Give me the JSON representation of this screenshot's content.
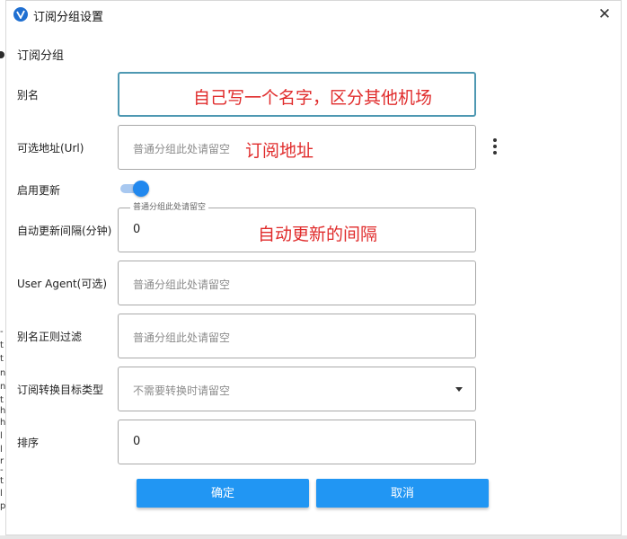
{
  "dialog": {
    "title": "订阅分组设置",
    "close_label": "✕"
  },
  "section_title": "订阅分组",
  "fields": {
    "alias": {
      "label": "别名",
      "value": "",
      "annotation": "自己写一个名字，区分其他机场"
    },
    "url": {
      "label": "可选地址(Url)",
      "placeholder": "普通分组此处请留空",
      "annotation": "订阅地址"
    },
    "enable_update": {
      "label": "启用更新",
      "checked": true
    },
    "update_interval": {
      "label": "自动更新间隔(分钟)",
      "value": "0",
      "floating_label": "普通分组此处请留空",
      "annotation": "自动更新的间隔"
    },
    "user_agent": {
      "label": "User Agent(可选)",
      "placeholder": "普通分组此处请留空"
    },
    "alias_filter": {
      "label": "别名正则过滤",
      "placeholder": "普通分组此处请留空"
    },
    "convert_target": {
      "label": "订阅转换目标类型",
      "placeholder": "不需要转换时请留空"
    },
    "sort": {
      "label": "排序",
      "value": "0"
    }
  },
  "buttons": {
    "ok": "确定",
    "cancel": "取消"
  },
  "background_fragments": [
    "-",
    "t",
    "t",
    "n",
    "n",
    "t",
    "h",
    "h",
    "l",
    "l",
    "r",
    "-",
    "t",
    "l",
    "p"
  ],
  "colors": {
    "accent": "#2196f3",
    "annotation": "#e02b2b",
    "focus_border": "#4e98b2"
  }
}
